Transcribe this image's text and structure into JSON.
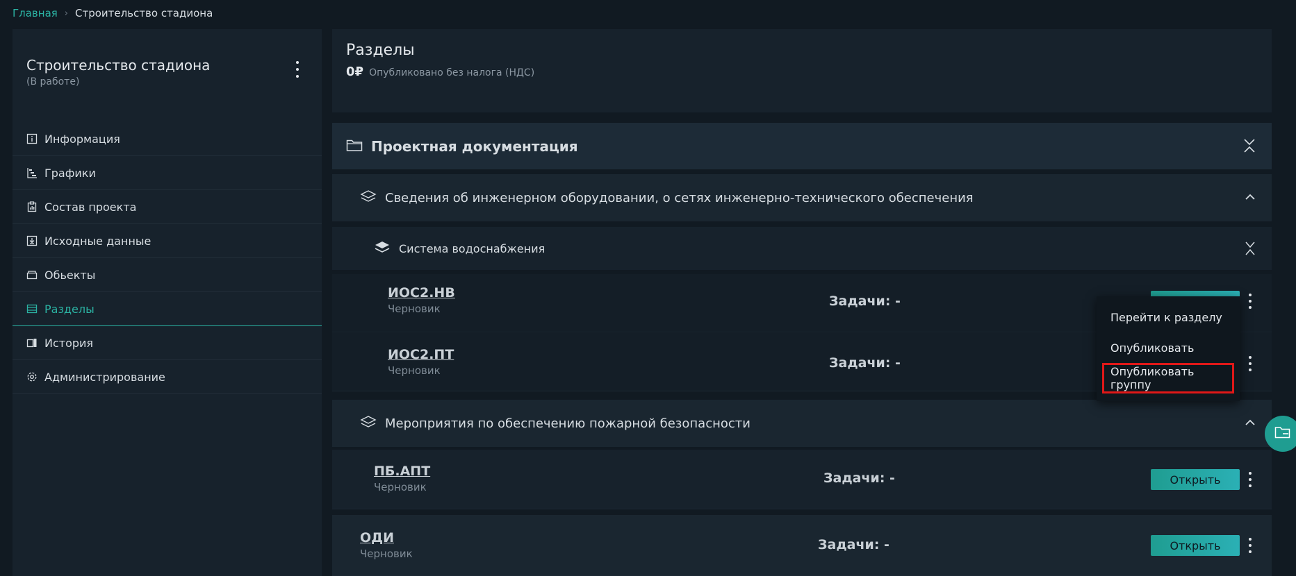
{
  "breadcrumb": {
    "home": "Главная",
    "separator": "›",
    "current": "Строительство стадиона"
  },
  "sidebar": {
    "title": "Строительство стадиона",
    "status": "(В работе)",
    "items": [
      {
        "label": "Информация",
        "icon": "info-icon"
      },
      {
        "label": "Графики",
        "icon": "gantt-icon"
      },
      {
        "label": "Состав проекта",
        "icon": "clipboard-icon"
      },
      {
        "label": "Исходные данные",
        "icon": "download-icon"
      },
      {
        "label": "Обьекты",
        "icon": "box-icon"
      },
      {
        "label": "Разделы",
        "icon": "sections-icon",
        "active": true
      },
      {
        "label": "История",
        "icon": "history-icon"
      },
      {
        "label": "Администрирование",
        "icon": "gear-icon"
      }
    ]
  },
  "header": {
    "title": "Разделы",
    "amount": "0₽",
    "note": "Опубликовано без налога (НДС)"
  },
  "folder": {
    "label": "Проектная документация"
  },
  "groups": [
    {
      "label": "Сведения об инженерном оборудовании, о сетях инженерно-технического обеспечения"
    },
    {
      "label": "Мероприятия по обеспечению пожарной безопасности"
    }
  ],
  "subgroup": {
    "label": "Система водоснабжения"
  },
  "items": [
    {
      "code": "ИОС2.НВ",
      "status": "Черновик",
      "tasks": "Задачи: -"
    },
    {
      "code": "ИОС2.ПТ",
      "status": "Черновик",
      "tasks": "Задачи: -"
    },
    {
      "code": "ПБ.АПТ",
      "status": "Черновик",
      "tasks": "Задачи: -",
      "button": "Открыть"
    },
    {
      "code": "ОДИ",
      "status": "Черновик",
      "tasks": "Задачи: -",
      "button": "Открыть"
    }
  ],
  "context_menu": {
    "items": [
      "Перейти к разделу",
      "Опубликовать",
      "Опубликовать группу"
    ]
  },
  "colors": {
    "accent": "#2bb3a3",
    "background": "#111a22",
    "panel": "#17222c",
    "highlight": "#e01818"
  }
}
